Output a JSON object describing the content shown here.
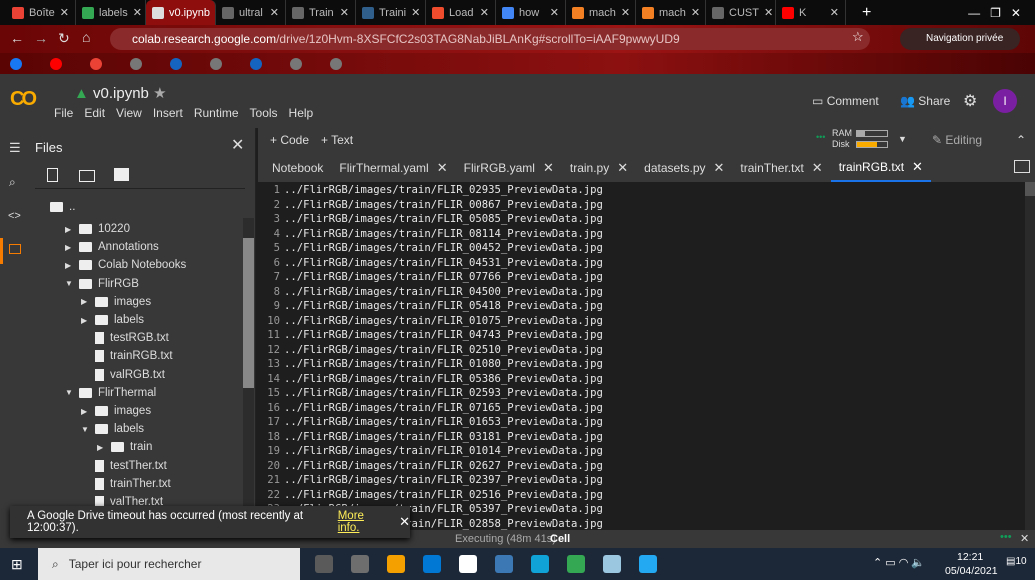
{
  "browser": {
    "tabs": [
      {
        "label": "Boîte",
        "icon": "gmail-icon",
        "color": "#ea4335"
      },
      {
        "label": "labels",
        "icon": "drive-icon",
        "color": "#34a853"
      },
      {
        "label": "v0.ipynb",
        "icon": "colab-icon",
        "color": "#dddddd",
        "active": true
      },
      {
        "label": "ultral",
        "icon": "github-icon",
        "color": "#666666"
      },
      {
        "label": "Train",
        "icon": "github-icon",
        "color": "#666666"
      },
      {
        "label": "Traini",
        "icon": "tds-icon",
        "color": "#2f5f8a"
      },
      {
        "label": "Load",
        "icon": "pytorch-icon",
        "color": "#ee4c2c"
      },
      {
        "label": "how",
        "icon": "google-icon",
        "color": "#4285f4"
      },
      {
        "label": "mach",
        "icon": "stackoverflow-icon",
        "color": "#f48024"
      },
      {
        "label": "mach",
        "icon": "stackoverflow-icon",
        "color": "#f48024"
      },
      {
        "label": "CUST",
        "icon": "github-icon",
        "color": "#666666"
      },
      {
        "label": "K",
        "icon": "youtube-icon",
        "color": "#ff0000"
      }
    ],
    "url_host": "colab.research.google.com",
    "url_path": "/drive/1z0Hvm-8XSFCfC2s03TAG8NabJiBLAnKg#scrollTo=iAAF9pwwyUD9",
    "private_label": "Navigation privée",
    "bookmark_icons": [
      "#1877f2",
      "#ff0000",
      "#ea4335",
      "#777777",
      "#1565c0",
      "#777777",
      "#1565c0",
      "#777777",
      "#777777"
    ]
  },
  "colab": {
    "logo": "CO",
    "notebook_name": "v0.ipynb",
    "menu": [
      "File",
      "Edit",
      "View",
      "Insert",
      "Runtime",
      "Tools",
      "Help"
    ],
    "comment": "Comment",
    "share": "Share",
    "avatar": "I",
    "add_code": "+ Code",
    "add_text": "+ Text",
    "ram": "RAM",
    "disk": "Disk",
    "ram_usage": 0.25,
    "disk_usage": 0.65,
    "editing": "Editing",
    "files_title": "Files",
    "parent": "..",
    "tree": [
      {
        "name": "10220",
        "type": "folder",
        "depth": 0,
        "expanded": false
      },
      {
        "name": "Annotations",
        "type": "folder",
        "depth": 0,
        "expanded": false
      },
      {
        "name": "Colab Notebooks",
        "type": "folder",
        "depth": 0,
        "expanded": false
      },
      {
        "name": "FlirRGB",
        "type": "folder",
        "depth": 0,
        "expanded": true
      },
      {
        "name": "images",
        "type": "folder",
        "depth": 1,
        "expanded": false
      },
      {
        "name": "labels",
        "type": "folder",
        "depth": 1,
        "expanded": false
      },
      {
        "name": "testRGB.txt",
        "type": "file",
        "depth": 1
      },
      {
        "name": "trainRGB.txt",
        "type": "file",
        "depth": 1
      },
      {
        "name": "valRGB.txt",
        "type": "file",
        "depth": 1
      },
      {
        "name": "FlirThermal",
        "type": "folder",
        "depth": 0,
        "expanded": true
      },
      {
        "name": "images",
        "type": "folder",
        "depth": 1,
        "expanded": false
      },
      {
        "name": "labels",
        "type": "folder",
        "depth": 1,
        "expanded": true
      },
      {
        "name": "train",
        "type": "folder",
        "depth": 2,
        "expanded": false
      },
      {
        "name": "testTher.txt",
        "type": "file",
        "depth": 1
      },
      {
        "name": "trainTher.txt",
        "type": "file",
        "depth": 1
      },
      {
        "name": "valTher.txt",
        "type": "file",
        "depth": 1
      }
    ],
    "editor_tabs": [
      {
        "label": "Notebook",
        "closable": false
      },
      {
        "label": "FlirThermal.yaml",
        "closable": true
      },
      {
        "label": "FlirRGB.yaml",
        "closable": true
      },
      {
        "label": "train.py",
        "closable": true
      },
      {
        "label": "datasets.py",
        "closable": true
      },
      {
        "label": "trainTher.txt",
        "closable": true
      },
      {
        "label": "trainRGB.txt",
        "closable": true,
        "active": true
      }
    ],
    "lines": [
      "../FlirRGB/images/train/FLIR_02935_PreviewData.jpg",
      "../FlirRGB/images/train/FLIR_00867_PreviewData.jpg",
      "../FlirRGB/images/train/FLIR_05085_PreviewData.jpg",
      "../FlirRGB/images/train/FLIR_08114_PreviewData.jpg",
      "../FlirRGB/images/train/FLIR_00452_PreviewData.jpg",
      "../FlirRGB/images/train/FLIR_04531_PreviewData.jpg",
      "../FlirRGB/images/train/FLIR_07766_PreviewData.jpg",
      "../FlirRGB/images/train/FLIR_04500_PreviewData.jpg",
      "../FlirRGB/images/train/FLIR_05418_PreviewData.jpg",
      "../FlirRGB/images/train/FLIR_01075_PreviewData.jpg",
      "../FlirRGB/images/train/FLIR_04743_PreviewData.jpg",
      "../FlirRGB/images/train/FLIR_02510_PreviewData.jpg",
      "../FlirRGB/images/train/FLIR_01080_PreviewData.jpg",
      "../FlirRGB/images/train/FLIR_05386_PreviewData.jpg",
      "../FlirRGB/images/train/FLIR_02593_PreviewData.jpg",
      "../FlirRGB/images/train/FLIR_07165_PreviewData.jpg",
      "../FlirRGB/images/train/FLIR_01653_PreviewData.jpg",
      "../FlirRGB/images/train/FLIR_03181_PreviewData.jpg",
      "../FlirRGB/images/train/FLIR_01014_PreviewData.jpg",
      "../FlirRGB/images/train/FLIR_02627_PreviewData.jpg",
      "../FlirRGB/images/train/FLIR_02397_PreviewData.jpg",
      "../FlirRGB/images/train/FLIR_02516_PreviewData.jpg",
      "../FlirRGB/images/train/FLIR_05397_PreviewData.jpg",
      "../FlirRGB/images/train/FLIR_02858_PreviewData.jpg"
    ],
    "status_executing": "Executing (48m 41s)",
    "status_cell": "Cell",
    "toast_text": "A Google Drive timeout has occurred (most recently at 12:00:37).",
    "toast_link": "More info."
  },
  "taskbar": {
    "search_placeholder": "Taper ici pour rechercher",
    "time": "12:21",
    "date": "05/04/2021",
    "notifications": "10",
    "apps": [
      "#5a5a5a",
      "#6e6e6e",
      "#f3a000",
      "#0078d4",
      "#ffffff",
      "#3c78b4",
      "#0fa3d8",
      "#34a853",
      "#9cc7e0",
      "#23a9f2"
    ]
  }
}
